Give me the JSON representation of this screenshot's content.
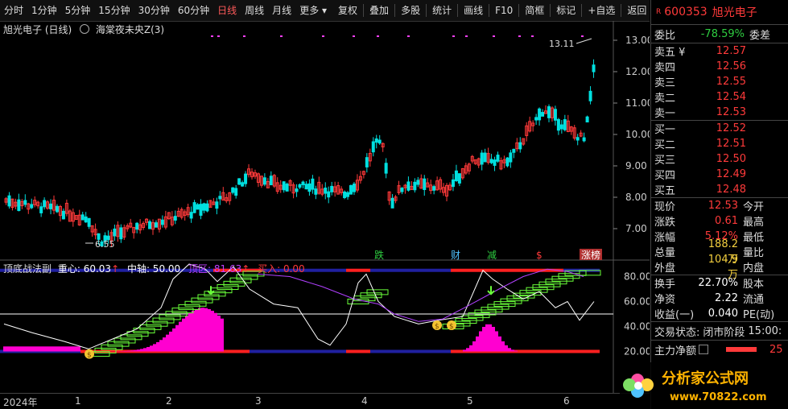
{
  "toolbar": {
    "periods": [
      "分时",
      "1分钟",
      "5分钟",
      "15分钟",
      "30分钟",
      "60分钟",
      "日线",
      "周线",
      "月线",
      "更多 ▾"
    ],
    "active_period": "日线",
    "tools": [
      "复权",
      "叠加",
      "多股",
      "统计",
      "画线",
      "F10",
      "简框",
      "标记",
      "+自选",
      "返回"
    ]
  },
  "chart": {
    "stock_label": "旭光电子 (日线)",
    "indicator_name": "海棠夜未央Z(3)",
    "high_label": "13.11",
    "low_label": "6.55",
    "price_axis": [
      "13.00",
      "12.00",
      "11.00",
      "10.00",
      "9.00",
      "8.00",
      "7.00"
    ],
    "markers": [
      "跌",
      "财",
      "减",
      "$",
      "涨榜"
    ]
  },
  "subchart": {
    "name": "顶底战法副",
    "zhongxin": "重心: 60.03",
    "zhongzhou": "中轴: 50.00",
    "dingqu": "顶区: 81.63",
    "mairu": "买入: 0.00",
    "axis": [
      "80.00",
      "60.00",
      "40.00",
      "20.00"
    ]
  },
  "xaxis": [
    "2024年",
    "1",
    "2",
    "3",
    "4",
    "5",
    "6"
  ],
  "quote": {
    "code": "600353",
    "name": "旭光电子",
    "weibi_label": "委比",
    "weibi": "-78.59%",
    "weicha_label": "委差",
    "sells": [
      {
        "label": "卖五 ¥",
        "price": "12.57"
      },
      {
        "label": "卖四",
        "price": "12.56"
      },
      {
        "label": "卖三",
        "price": "12.55"
      },
      {
        "label": "卖二",
        "price": "12.54"
      },
      {
        "label": "卖一",
        "price": "12.53"
      }
    ],
    "buys": [
      {
        "label": "买一",
        "price": "12.52"
      },
      {
        "label": "买二",
        "price": "12.51"
      },
      {
        "label": "买三",
        "price": "12.50"
      },
      {
        "label": "买四",
        "price": "12.49"
      },
      {
        "label": "买五",
        "price": "12.48"
      }
    ],
    "stats": [
      {
        "label": "现价",
        "value": "12.53",
        "extra": "今开"
      },
      {
        "label": "涨跌",
        "value": "0.61",
        "extra": "最高"
      },
      {
        "label": "涨幅",
        "value": "5.12%",
        "extra": "最低"
      },
      {
        "label": "总量",
        "value": "188.2万",
        "extra": "量比"
      },
      {
        "label": "外盘",
        "value": "104.9万",
        "extra": "内盘"
      }
    ],
    "stats2": [
      {
        "label": "换手",
        "value": "22.70%",
        "extra": "股本"
      },
      {
        "label": "净资",
        "value": "2.22",
        "extra": "流通"
      },
      {
        "label": "收益(一)",
        "value": "0.040",
        "extra": "PE(动)"
      }
    ],
    "trade_status_label": "交易状态:",
    "trade_status": "闭市阶段",
    "trade_time": "15:00:",
    "net_inflow_label": "主力净额",
    "net_inflow": "25"
  },
  "watermark": {
    "text": "分析家公式网",
    "url": "www.70822.com"
  },
  "colors": {
    "up": "#ff3a3a",
    "down": "#00e0e0",
    "accent": "#ff3a3a",
    "magenta": "#ff00d0",
    "green": "#2ecc40"
  }
}
